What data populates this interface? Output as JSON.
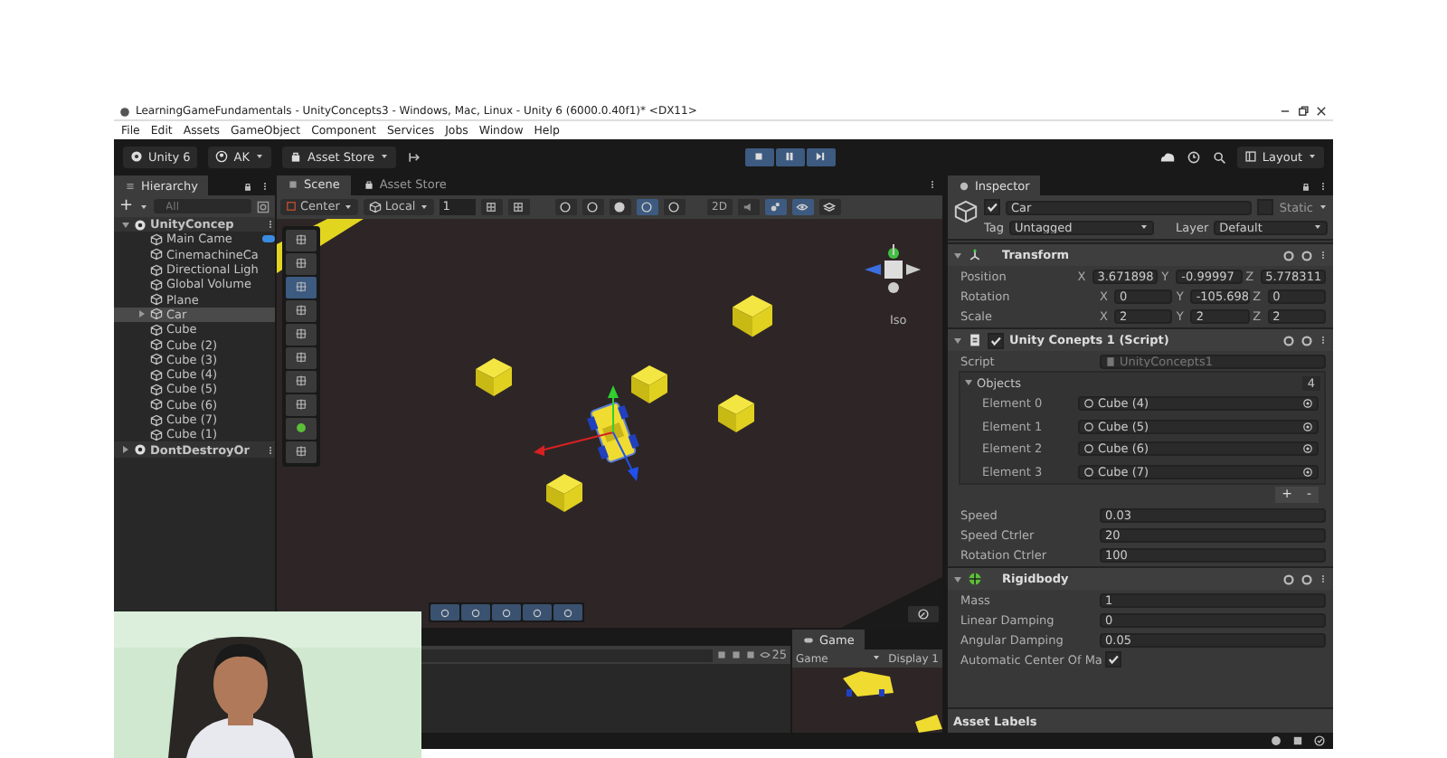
{
  "window": {
    "title": "LearningGameFundamentals - UnityConcepts3 - Windows, Mac, Linux - Unity 6 (6000.0.40f1)* <DX11>"
  },
  "menu": [
    "File",
    "Edit",
    "Assets",
    "GameObject",
    "Component",
    "Services",
    "Jobs",
    "Window",
    "Help"
  ],
  "toolbar": {
    "unity_label": "Unity 6",
    "account": "AK",
    "asset_store": "Asset Store",
    "layout": "Layout"
  },
  "hierarchy": {
    "title": "Hierarchy",
    "search_placeholder": "All",
    "add": "+",
    "items": [
      {
        "label": "UnityConcep",
        "kind": "scene",
        "expanded": true,
        "selected": false,
        "children": [
          {
            "label": "Main Came",
            "expandable": false,
            "selected": false,
            "badge": true
          },
          {
            "label": "CinemachineCa",
            "expandable": false,
            "selected": false,
            "badge": false
          },
          {
            "label": "Directional Ligh",
            "expandable": false,
            "selected": false,
            "badge": false
          },
          {
            "label": "Global Volume",
            "expandable": false,
            "selected": false,
            "badge": false
          },
          {
            "label": "Plane",
            "expandable": false,
            "selected": false,
            "badge": false
          },
          {
            "label": "Car",
            "expandable": true,
            "selected": true,
            "badge": false
          },
          {
            "label": "Cube",
            "expandable": false,
            "selected": false,
            "badge": false
          },
          {
            "label": "Cube (2)",
            "expandable": false,
            "selected": false,
            "badge": false
          },
          {
            "label": "Cube (3)",
            "expandable": false,
            "selected": false,
            "badge": false
          },
          {
            "label": "Cube (4)",
            "expandable": false,
            "selected": false,
            "badge": false
          },
          {
            "label": "Cube (5)",
            "expandable": false,
            "selected": false,
            "badge": false
          },
          {
            "label": "Cube (6)",
            "expandable": false,
            "selected": false,
            "badge": false
          },
          {
            "label": "Cube (7)",
            "expandable": false,
            "selected": false,
            "badge": false
          },
          {
            "label": "Cube (1)",
            "expandable": false,
            "selected": false,
            "badge": false
          }
        ]
      },
      {
        "label": "DontDestroyOr",
        "kind": "scene",
        "expanded": false,
        "selected": false
      }
    ]
  },
  "scene": {
    "tabs": [
      {
        "label": "Scene",
        "selected": true
      },
      {
        "label": "Asset Store",
        "selected": false
      }
    ],
    "pivot": "Center",
    "space": "Local",
    "grid_size": "1",
    "mode_2d": "2D",
    "view_label": "Iso"
  },
  "bottom": {
    "visible_count": "25",
    "game_tab": "Game",
    "game_view": "Game",
    "display": "Display 1"
  },
  "inspector": {
    "title": "Inspector",
    "object": {
      "name": "Car",
      "active": true,
      "static_label": "Static",
      "static": false,
      "tag_label": "Tag",
      "tag": "Untagged",
      "layer_label": "Layer",
      "layer": "Default"
    },
    "transform": {
      "title": "Transform",
      "expanded": true,
      "rows": [
        {
          "label": "Position",
          "values": [
            {
              "axis": "X",
              "value": "3.671898"
            },
            {
              "axis": "Y",
              "value": "-0.99997"
            },
            {
              "axis": "Z",
              "value": "5.778311"
            }
          ]
        },
        {
          "label": "Rotation",
          "values": [
            {
              "axis": "X",
              "value": "0"
            },
            {
              "axis": "Y",
              "value": "-105.698"
            },
            {
              "axis": "Z",
              "value": "0"
            }
          ]
        },
        {
          "label": "Scale",
          "values": [
            {
              "axis": "X",
              "value": "2"
            },
            {
              "axis": "Y",
              "value": "2"
            },
            {
              "axis": "Z",
              "value": "2"
            }
          ]
        }
      ]
    },
    "script": {
      "title": "Unity Conepts 1 (Script)",
      "expanded": true,
      "enabled": true,
      "script_label": "Script",
      "script_value": "UnityConcepts1",
      "list": {
        "label": "Objects",
        "expanded": true,
        "count": "4",
        "add": "+",
        "remove": "-",
        "elements": [
          {
            "label": "Element 0",
            "value": "Cube (4)"
          },
          {
            "label": "Element 1",
            "value": "Cube (5)"
          },
          {
            "label": "Element 2",
            "value": "Cube (6)"
          },
          {
            "label": "Element 3",
            "value": "Cube (7)"
          }
        ]
      },
      "fields": [
        {
          "label": "Speed",
          "value": "0.03"
        },
        {
          "label": "Speed Ctrler",
          "value": "20"
        },
        {
          "label": "Rotation Ctrler",
          "value": "100"
        }
      ]
    },
    "rigidbody": {
      "title": "Rigidbody",
      "expanded": true,
      "fields": [
        {
          "label": "Mass",
          "kind": "text",
          "value": "1"
        },
        {
          "label": "Linear Damping",
          "kind": "text",
          "value": "0"
        },
        {
          "label": "Angular Damping",
          "kind": "text",
          "value": "0.05"
        },
        {
          "label": "Automatic Center Of Ma",
          "kind": "check",
          "checked": true
        }
      ]
    },
    "asset_labels": "Asset Labels"
  }
}
